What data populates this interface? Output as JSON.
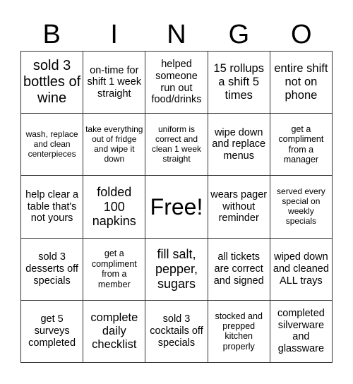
{
  "header": [
    "B",
    "I",
    "N",
    "G",
    "O"
  ],
  "cells": [
    {
      "text": "sold 3 bottles of wine",
      "size": "s20"
    },
    {
      "text": "on-time for shift 1 week straight",
      "size": "s15"
    },
    {
      "text": "helped someone run out food/drinks",
      "size": "s15"
    },
    {
      "text": "15 rollups a shift 5 times",
      "size": "s17"
    },
    {
      "text": "entire shift not on phone",
      "size": "s17"
    },
    {
      "text": "wash, replace and clean centerpieces",
      "size": "s12"
    },
    {
      "text": "take everything out of fridge and wipe it down",
      "size": "s12"
    },
    {
      "text": "uniform is correct and clean 1 week straight",
      "size": "s12"
    },
    {
      "text": "wipe down and replace menus",
      "size": "s15"
    },
    {
      "text": "get a compliment from a manager",
      "size": "s13"
    },
    {
      "text": "help clear a table that's not yours",
      "size": "s15"
    },
    {
      "text": "folded 100 napkins",
      "size": "s18"
    },
    {
      "text": "Free!",
      "size": "free"
    },
    {
      "text": "wears pager without reminder",
      "size": "s15"
    },
    {
      "text": "served every special on weekly specials",
      "size": "s12"
    },
    {
      "text": "sold 3 desserts off specials",
      "size": "s15"
    },
    {
      "text": "get a compliment from a member",
      "size": "s13"
    },
    {
      "text": "fill salt, pepper, sugars",
      "size": "s18"
    },
    {
      "text": "all tickets are correct and signed",
      "size": "s15"
    },
    {
      "text": "wiped down and cleaned ALL trays",
      "size": "s15"
    },
    {
      "text": "get 5 surveys completed",
      "size": "s15"
    },
    {
      "text": "complete daily checklist",
      "size": "s17"
    },
    {
      "text": "sold 3 cocktails off specials",
      "size": "s15"
    },
    {
      "text": "stocked and prepped kitchen properly",
      "size": "s13"
    },
    {
      "text": "completed silverware and glassware",
      "size": "s15"
    }
  ]
}
